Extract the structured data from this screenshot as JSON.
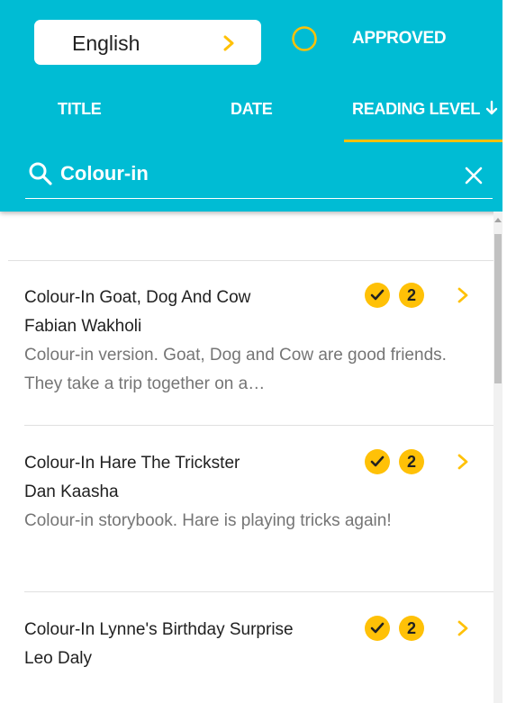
{
  "header": {
    "language": "English",
    "approved_label": "APPROVED",
    "tabs": [
      {
        "label": "TITLE"
      },
      {
        "label": "DATE"
      },
      {
        "label": "READING LEVEL",
        "active": true
      }
    ],
    "search": {
      "value": "Colour-in",
      "placeholder": ""
    }
  },
  "books": [
    {
      "title": "Colour-In Goat, Dog And Cow",
      "author": "Fabian Wakholi",
      "description": "Colour-in version. Goat, Dog and Cow are good friends. They take a trip together on a…",
      "approved": true,
      "reading_level": "2"
    },
    {
      "title": "Colour-In Hare The Trickster",
      "author": "Dan Kaasha",
      "description": "Colour-in storybook. Hare is playing tricks again!",
      "approved": true,
      "reading_level": "2"
    },
    {
      "title": "Colour-In Lynne's Birthday Surprise",
      "author": "Leo Daly",
      "description": "",
      "approved": true,
      "reading_level": "2"
    }
  ],
  "colors": {
    "header_bg": "#00bcd4",
    "accent": "#ffc107",
    "description_text": "#757575"
  },
  "icons": [
    "chevron-right-icon",
    "approved-circle-icon",
    "sort-arrow-icon",
    "search-icon",
    "close-icon",
    "check-icon"
  ],
  "scrollbar": {
    "visible_fraction": 0.3
  }
}
